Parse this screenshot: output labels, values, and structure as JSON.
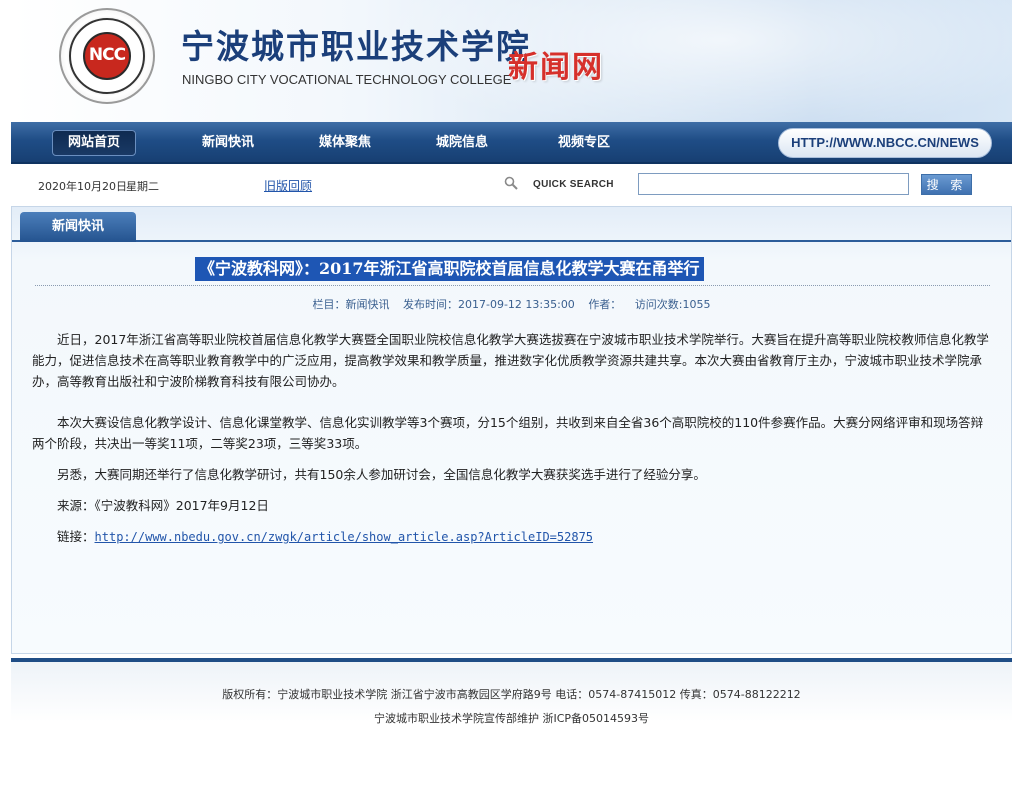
{
  "header": {
    "logo_text": "NCC",
    "college_cn": "宁波城市职业技术学院",
    "college_en": "NINGBO CITY VOCATIONAL TECHNOLOGY COLLEGE",
    "site_name": "新闻网"
  },
  "nav": {
    "items": [
      {
        "label": "网站首页",
        "active": true
      },
      {
        "label": "新闻快讯"
      },
      {
        "label": "媒体聚焦"
      },
      {
        "label": "城院信息"
      },
      {
        "label": "视频专区"
      }
    ],
    "url_badge": "HTTP://WWW.NBCC.CN/NEWS"
  },
  "infobar": {
    "date": "2020年10月20日",
    "weekday": "星期二",
    "old_version_link": "旧版回顾",
    "quick_search_label": "QUICK SEARCH",
    "search_value": "",
    "search_button": "搜 索"
  },
  "panel": {
    "tab_label": "新闻快讯",
    "title": "《宁波教科网》：2017年浙江省高职院校首届信息化教学大赛在甬举行",
    "meta": {
      "column": "栏目：新闻快讯",
      "publish_time": "发布时间：2017-09-12 13:35:00",
      "author": "作者：",
      "views": "访问次数:1055"
    },
    "paragraphs": [
      "近日，2017年浙江省高等职业院校首届信息化教学大赛暨全国职业院校信息化教学大赛选拔赛在宁波城市职业技术学院举行。大赛旨在提升高等职业院校教师信息化教学能力，促进信息技术在高等职业教育教学中的广泛应用，提高教学效果和教学质量，推进数字化优质教学资源共建共享。本次大赛由省教育厅主办，宁波城市职业技术学院承办，高等教育出版社和宁波阶梯教育科技有限公司协办。",
      "本次大赛设信息化教学设计、信息化课堂教学、信息化实训教学等3个赛项，分15个组别，共收到来自全省36个高职院校的110件参赛作品。大赛分网络评审和现场答辩两个阶段，共决出一等奖11项，二等奖23项，三等奖33项。",
      "另悉，大赛同期还举行了信息化教学研讨，共有150余人参加研讨会，全国信息化教学大赛获奖选手进行了经验分享。",
      "来源：《宁波教科网》2017年9月12日"
    ],
    "link_label": "链接：",
    "link_url": "http://www.nbedu.gov.cn/zwgk/article/show_article.asp?ArticleID=52875"
  },
  "footer": {
    "line1": "版权所有：宁波城市职业技术学院  浙江省宁波市高教园区学府路9号  电话：0574-87415012  传真：0574-88122212",
    "line2": "宁波城市职业技术学院宣传部维护  浙ICP备05014593号"
  },
  "colors": {
    "nav_blue": "#1f4d86",
    "title_highlight": "#1e56b4",
    "site_name_red": "#d6302b",
    "link_blue": "#2255aa"
  }
}
